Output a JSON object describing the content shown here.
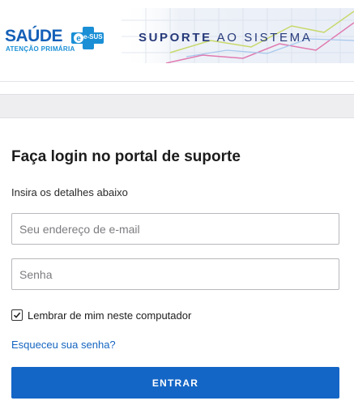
{
  "header": {
    "logo_word": "SAÚDE",
    "logo_badge": "e-SUS",
    "logo_subtitle": "ATENÇÃO PRIMÁRIA",
    "support_title_strong": "SUPORTE",
    "support_title_rest": " AO SISTEMA"
  },
  "login": {
    "title": "Faça login no portal de suporte",
    "subtitle": "Insira os detalhes abaixo",
    "email_placeholder": "Seu endereço de e-mail",
    "password_placeholder": "Senha",
    "remember_label": "Lembrar de mim neste computador",
    "remember_checked": true,
    "forgot_link": "Esqueceu sua senha?",
    "submit_label": "ENTRAR"
  },
  "colors": {
    "brand_blue": "#1560b8",
    "button_blue": "#1466c6",
    "link_blue": "#1565c0",
    "header_title": "#273a7a"
  }
}
